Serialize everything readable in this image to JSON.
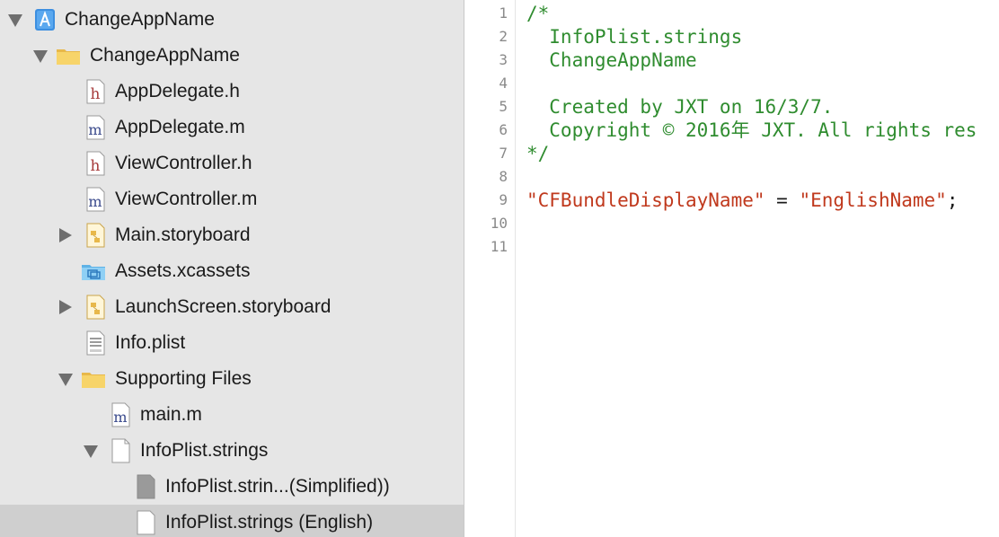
{
  "navigator": {
    "items": [
      {
        "label": "ChangeAppName",
        "icon": "xcode-project-icon",
        "disclosure": "down"
      },
      {
        "label": "ChangeAppName",
        "icon": "folder-icon",
        "disclosure": "down"
      },
      {
        "label": "AppDelegate.h",
        "icon": "header-file-icon",
        "disclosure": ""
      },
      {
        "label": "AppDelegate.m",
        "icon": "implementation-file-icon",
        "disclosure": ""
      },
      {
        "label": "ViewController.h",
        "icon": "header-file-icon",
        "disclosure": ""
      },
      {
        "label": "ViewController.m",
        "icon": "implementation-file-icon",
        "disclosure": ""
      },
      {
        "label": "Main.storyboard",
        "icon": "storyboard-file-icon",
        "disclosure": "right"
      },
      {
        "label": "Assets.xcassets",
        "icon": "asset-catalog-icon",
        "disclosure": ""
      },
      {
        "label": "LaunchScreen.storyboard",
        "icon": "storyboard-file-icon",
        "disclosure": "right"
      },
      {
        "label": "Info.plist",
        "icon": "plist-file-icon",
        "disclosure": ""
      },
      {
        "label": "Supporting Files",
        "icon": "folder-icon",
        "disclosure": "down"
      },
      {
        "label": "main.m",
        "icon": "implementation-file-icon",
        "disclosure": ""
      },
      {
        "label": "InfoPlist.strings",
        "icon": "strings-file-icon",
        "disclosure": "down"
      },
      {
        "label": "InfoPlist.strin...(Simplified))",
        "icon": "localized-file-icon",
        "disclosure": ""
      },
      {
        "label": "InfoPlist.strings (English)",
        "icon": "localized-file-icon",
        "disclosure": "",
        "selected": true
      }
    ]
  },
  "editor": {
    "line_numbers": [
      "1",
      "2",
      "3",
      "4",
      "5",
      "6",
      "7",
      "8",
      "9",
      "10",
      "11"
    ],
    "lines": [
      {
        "c": "/*"
      },
      {
        "c": "  InfoPlist.strings"
      },
      {
        "c": "  ChangeAppName"
      },
      {
        "c": ""
      },
      {
        "c": "  Created by JXT on 16/3/7."
      },
      {
        "c": "  Copyright © 2016年 JXT. All rights res"
      },
      {
        "c": "*/"
      },
      {
        "c": ""
      },
      {
        "k": "\"CFBundleDisplayName\"",
        "op": " = ",
        "v": "\"EnglishName\"",
        "end": ";"
      },
      {
        "c": ""
      },
      {
        "c": ""
      }
    ]
  },
  "colors": {
    "sidebar_bg": "#e6e6e6",
    "selection": "#cfcfcf",
    "comment": "#2f8c2f",
    "string": "#c0391d"
  }
}
